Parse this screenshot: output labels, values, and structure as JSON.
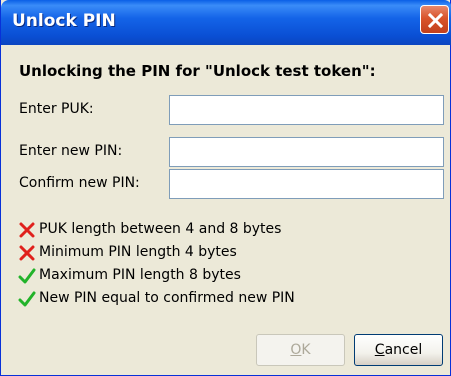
{
  "window": {
    "title": "Unlock PIN"
  },
  "heading": "Unlocking the PIN for \"Unlock test token\":",
  "fields": {
    "puk": {
      "label": "Enter PUK:",
      "value": ""
    },
    "new_pin": {
      "label": "Enter new PIN:",
      "value": ""
    },
    "confirm_pin": {
      "label": "Confirm new PIN:",
      "value": ""
    }
  },
  "rules": [
    {
      "text": "PUK length between 4 and 8 bytes",
      "status": "fail",
      "icon": "red-x-icon",
      "color": "#e0201c"
    },
    {
      "text": "Minimum PIN length 4 bytes",
      "status": "fail",
      "icon": "red-x-icon",
      "color": "#e0201c"
    },
    {
      "text": "Maximum PIN length 8 bytes",
      "status": "pass",
      "icon": "green-check-icon",
      "color": "#22b32a"
    },
    {
      "text": "New PIN equal to confirmed new PIN",
      "status": "pass",
      "icon": "green-check-icon",
      "color": "#22b32a"
    }
  ],
  "buttons": {
    "ok": {
      "mnemonic": "O",
      "rest": "K",
      "enabled": false
    },
    "cancel": {
      "mnemonic": "C",
      "rest": "ancel",
      "enabled": true
    }
  },
  "colors": {
    "titlebar": "#0a5fe6",
    "dialog_bg": "#ece9d8",
    "close_button": "#d9542c"
  }
}
